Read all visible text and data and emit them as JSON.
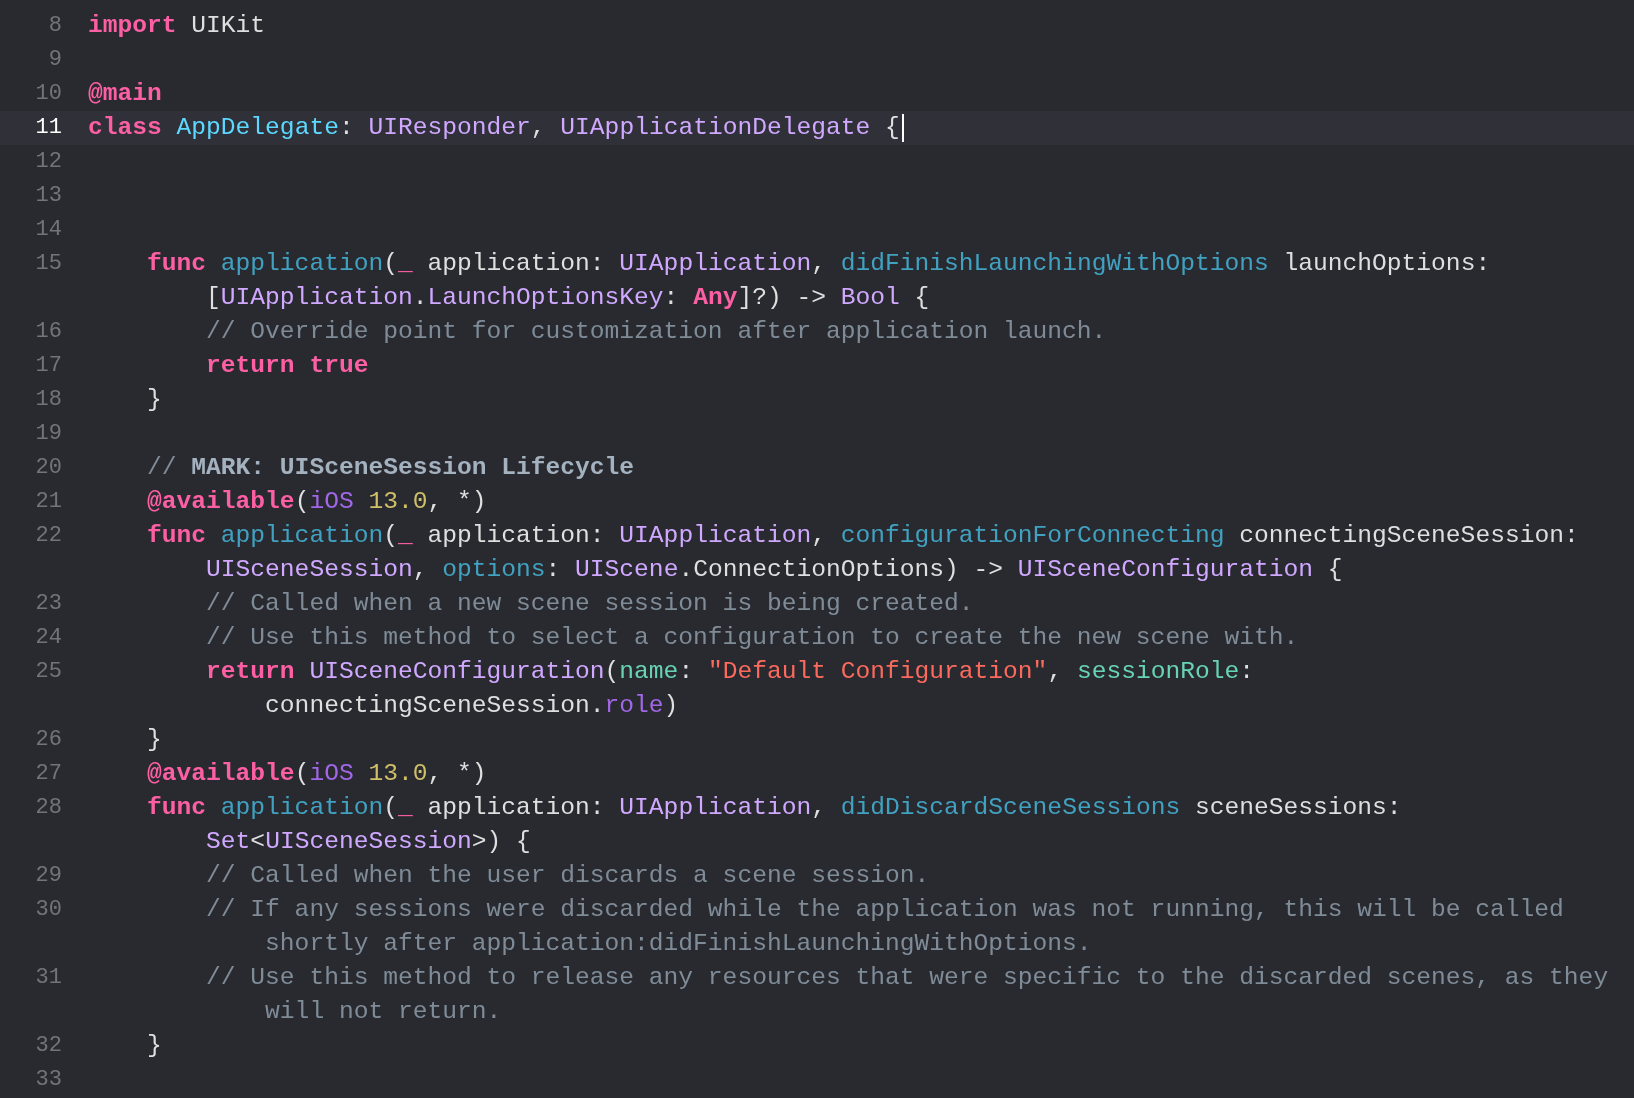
{
  "editor": {
    "lines": [
      {
        "number": "8",
        "selected": false,
        "tokens": [
          {
            "kind": "keyword",
            "text": "import"
          },
          {
            "kind": "plain",
            "text": " UIKit"
          }
        ]
      },
      {
        "number": "9",
        "selected": false
      },
      {
        "number": "10",
        "selected": false,
        "tokens": [
          {
            "kind": "keyword",
            "text": "@main"
          }
        ]
      },
      {
        "number": "11",
        "selected": true,
        "tokens": [
          {
            "kind": "keyword",
            "text": "class "
          },
          {
            "kind": "decltype",
            "text": "AppDelegate"
          },
          {
            "kind": "plain",
            "text": ": "
          },
          {
            "kind": "type",
            "text": "UIResponder"
          },
          {
            "kind": "plain",
            "text": ", "
          },
          {
            "kind": "type",
            "text": "UIApplicationDelegate"
          },
          {
            "kind": "plain",
            "text": " {"
          }
        ]
      },
      {
        "number": "12",
        "selected": false
      },
      {
        "number": "13",
        "selected": false
      },
      {
        "number": "14",
        "selected": false
      },
      {
        "number": "15",
        "selected": false,
        "tokens": [
          {
            "kind": "keyword",
            "text": "    func "
          },
          {
            "kind": "decl",
            "text": "application"
          },
          {
            "kind": "plain",
            "text": "("
          },
          {
            "kind": "keyword",
            "text": "_"
          },
          {
            "kind": "plain",
            "text": " application: "
          },
          {
            "kind": "type",
            "text": "UIApplication"
          },
          {
            "kind": "plain",
            "text": ", "
          },
          {
            "kind": "decl",
            "text": "didFinishLaunchingWithOptions"
          },
          {
            "kind": "plain",
            "text": " launchOptions:"
          }
        ]
      },
      {
        "selected": false,
        "tokens": [
          {
            "kind": "plain",
            "text": "        ["
          },
          {
            "kind": "type",
            "text": "UIApplication"
          },
          {
            "kind": "plain",
            "text": "."
          },
          {
            "kind": "type",
            "text": "LaunchOptionsKey"
          },
          {
            "kind": "plain",
            "text": ": "
          },
          {
            "kind": "keyword",
            "text": "Any"
          },
          {
            "kind": "plain",
            "text": "]?) -> "
          },
          {
            "kind": "type",
            "text": "Bool"
          },
          {
            "kind": "plain",
            "text": " {"
          }
        ]
      },
      {
        "number": "16",
        "selected": false,
        "tokens": [
          {
            "kind": "comment",
            "text": "        // Override point for customization after application launch."
          }
        ]
      },
      {
        "number": "17",
        "selected": false,
        "tokens": [
          {
            "kind": "keyword",
            "text": "        return true"
          }
        ]
      },
      {
        "number": "18",
        "selected": false,
        "tokens": [
          {
            "kind": "plain",
            "text": "    }"
          }
        ]
      },
      {
        "number": "19",
        "selected": false
      },
      {
        "number": "20",
        "selected": false,
        "tokens": [
          {
            "kind": "comment",
            "text": "    // "
          },
          {
            "kind": "mark",
            "text": "MARK: UISceneSession Lifecycle"
          }
        ]
      },
      {
        "number": "21",
        "selected": false,
        "tokens": [
          {
            "kind": "keyword",
            "text": "    @available"
          },
          {
            "kind": "plain",
            "text": "("
          },
          {
            "kind": "property",
            "text": "iOS "
          },
          {
            "kind": "number",
            "text": "13.0"
          },
          {
            "kind": "plain",
            "text": ", *)"
          }
        ]
      },
      {
        "number": "22",
        "selected": false,
        "tokens": [
          {
            "kind": "keyword",
            "text": "    func "
          },
          {
            "kind": "decl",
            "text": "application"
          },
          {
            "kind": "plain",
            "text": "("
          },
          {
            "kind": "keyword",
            "text": "_"
          },
          {
            "kind": "plain",
            "text": " application: "
          },
          {
            "kind": "type",
            "text": "UIApplication"
          },
          {
            "kind": "plain",
            "text": ", "
          },
          {
            "kind": "decl",
            "text": "configurationForConnecting"
          },
          {
            "kind": "plain",
            "text": " connectingSceneSession:"
          }
        ]
      },
      {
        "selected": false,
        "tokens": [
          {
            "kind": "type",
            "text": "        UISceneSession"
          },
          {
            "kind": "plain",
            "text": ", "
          },
          {
            "kind": "decl",
            "text": "options"
          },
          {
            "kind": "plain",
            "text": ": "
          },
          {
            "kind": "type",
            "text": "UIScene"
          },
          {
            "kind": "plain",
            "text": ".ConnectionOptions) -> "
          },
          {
            "kind": "type",
            "text": "UISceneConfiguration"
          },
          {
            "kind": "plain",
            "text": " {"
          }
        ]
      },
      {
        "number": "23",
        "selected": false,
        "tokens": [
          {
            "kind": "comment",
            "text": "        // Called when a new scene session is being created."
          }
        ]
      },
      {
        "number": "24",
        "selected": false,
        "tokens": [
          {
            "kind": "comment",
            "text": "        // Use this method to select a configuration to create the new scene with."
          }
        ]
      },
      {
        "number": "25",
        "selected": false,
        "tokens": [
          {
            "kind": "keyword",
            "text": "        return "
          },
          {
            "kind": "type",
            "text": "UISceneConfiguration"
          },
          {
            "kind": "plain",
            "text": "("
          },
          {
            "kind": "member",
            "text": "name"
          },
          {
            "kind": "plain",
            "text": ": "
          },
          {
            "kind": "string",
            "text": "\"Default Configuration\""
          },
          {
            "kind": "plain",
            "text": ", "
          },
          {
            "kind": "member",
            "text": "sessionRole"
          },
          {
            "kind": "plain",
            "text": ":"
          }
        ]
      },
      {
        "selected": false,
        "tokens": [
          {
            "kind": "plain",
            "text": "            connectingSceneSession."
          },
          {
            "kind": "property",
            "text": "role"
          },
          {
            "kind": "plain",
            "text": ")"
          }
        ]
      },
      {
        "number": "26",
        "selected": false,
        "tokens": [
          {
            "kind": "plain",
            "text": "    }"
          }
        ]
      },
      {
        "number": "27",
        "selected": false,
        "tokens": [
          {
            "kind": "keyword",
            "text": "    @available"
          },
          {
            "kind": "plain",
            "text": "("
          },
          {
            "kind": "property",
            "text": "iOS "
          },
          {
            "kind": "number",
            "text": "13.0"
          },
          {
            "kind": "plain",
            "text": ", *)"
          }
        ]
      },
      {
        "number": "28",
        "selected": false,
        "tokens": [
          {
            "kind": "keyword",
            "text": "    func "
          },
          {
            "kind": "decl",
            "text": "application"
          },
          {
            "kind": "plain",
            "text": "("
          },
          {
            "kind": "keyword",
            "text": "_"
          },
          {
            "kind": "plain",
            "text": " application: "
          },
          {
            "kind": "type",
            "text": "UIApplication"
          },
          {
            "kind": "plain",
            "text": ", "
          },
          {
            "kind": "decl",
            "text": "didDiscardSceneSessions"
          },
          {
            "kind": "plain",
            "text": " sceneSessions:"
          }
        ]
      },
      {
        "selected": false,
        "tokens": [
          {
            "kind": "type",
            "text": "        Set"
          },
          {
            "kind": "plain",
            "text": "<"
          },
          {
            "kind": "type",
            "text": "UISceneSession"
          },
          {
            "kind": "plain",
            "text": ">) {"
          }
        ]
      },
      {
        "number": "29",
        "selected": false,
        "tokens": [
          {
            "kind": "comment",
            "text": "        // Called when the user discards a scene session."
          }
        ]
      },
      {
        "number": "30",
        "selected": false,
        "tokens": [
          {
            "kind": "comment",
            "text": "        // If any sessions were discarded while the application was not running, this will be called"
          }
        ]
      },
      {
        "selected": false,
        "tokens": [
          {
            "kind": "comment",
            "text": "            shortly after application:didFinishLaunchingWithOptions."
          }
        ]
      },
      {
        "number": "31",
        "selected": false,
        "tokens": [
          {
            "kind": "comment",
            "text": "        // Use this method to release any resources that were specific to the discarded scenes, as they"
          }
        ]
      },
      {
        "selected": false,
        "tokens": [
          {
            "kind": "comment",
            "text": "            will not return."
          }
        ]
      },
      {
        "number": "32",
        "selected": false,
        "tokens": [
          {
            "kind": "plain",
            "text": "    }"
          }
        ]
      },
      {
        "number": "33",
        "selected": false
      }
    ]
  }
}
